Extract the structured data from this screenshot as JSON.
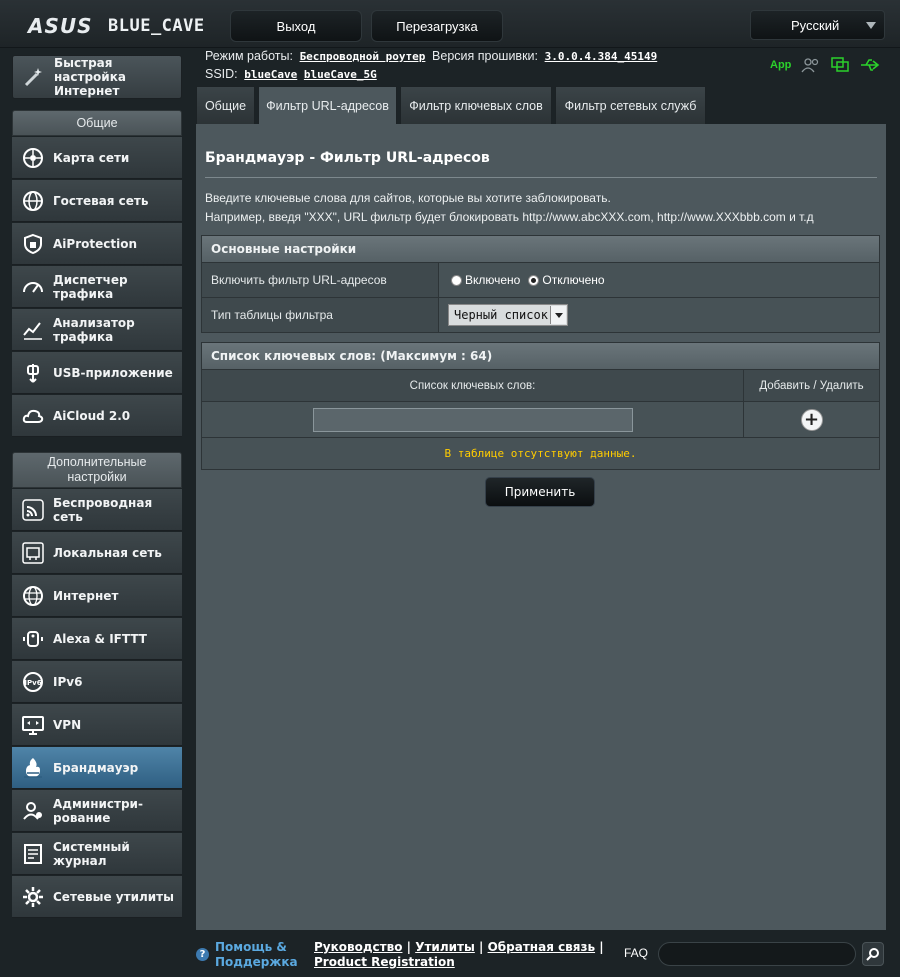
{
  "header": {
    "logo": "ASUS",
    "model": "BLUE_CAVE",
    "logout": "Выход",
    "reboot": "Перезагрузка",
    "language": "Русский"
  },
  "info": {
    "mode_label": "Режим работы:",
    "mode_value": "Беспроводной роутер",
    "firmware_label": "Версия прошивки:",
    "firmware_value": "3.0.0.4.384_45149",
    "ssid_label": "SSID:",
    "ssid_1": "blueCave",
    "ssid_2": "blueCave_5G",
    "app_label": "App"
  },
  "sidebar": {
    "quick_setup": "Быстрая настройка Интернет",
    "general_head": "Общие",
    "general": [
      {
        "label": "Карта сети",
        "icon": "network-map-icon"
      },
      {
        "label": "Гостевая сеть",
        "icon": "guest-network-icon"
      },
      {
        "label": "AiProtection",
        "icon": "aiprotection-icon"
      },
      {
        "label": "Диспетчер трафика",
        "icon": "traffic-manager-icon"
      },
      {
        "label": "Анализатор трафика",
        "icon": "traffic-analyzer-icon"
      },
      {
        "label": "USB-приложение",
        "icon": "usb-icon"
      },
      {
        "label": "AiCloud 2.0",
        "icon": "cloud-icon"
      }
    ],
    "advanced_head": "Дополнительные настройки",
    "advanced": [
      {
        "label": "Беспроводная сеть",
        "icon": "wireless-icon"
      },
      {
        "label": "Локальная сеть",
        "icon": "lan-icon"
      },
      {
        "label": "Интернет",
        "icon": "globe-icon"
      },
      {
        "label": "Alexa & IFTTT",
        "icon": "alexa-icon"
      },
      {
        "label": "IPv6",
        "icon": "ipv6-icon"
      },
      {
        "label": "VPN",
        "icon": "vpn-icon"
      },
      {
        "label": "Брандмауэр",
        "icon": "firewall-icon"
      },
      {
        "label": "Администри- рование",
        "icon": "admin-icon"
      },
      {
        "label": "Системный журнал",
        "icon": "log-icon"
      },
      {
        "label": "Сетевые утилиты",
        "icon": "tools-icon"
      }
    ]
  },
  "tabs": [
    "Общие",
    "Фильтр URL-адресов",
    "Фильтр ключевых слов",
    "Фильтр сетевых служб"
  ],
  "main": {
    "title": "Брандмауэр - Фильтр URL-адресов",
    "desc1": "Введите ключевые слова для сайтов, которые вы хотите заблокировать.",
    "desc2": "Например, введя \"XXX\", URL фильтр будет блокировать http://www.abcXXX.com, http://www.XXXbbb.com и т.д",
    "basic_head": "Основные настройки",
    "enable_label": "Включить фильтр URL-адресов",
    "enable_on": "Включено",
    "enable_off": "Отключено",
    "enable_selected": "Отключено",
    "table_type_label": "Тип таблицы фильтра",
    "table_type_value": "Черный список",
    "list_head": "Список ключевых слов: (Максимум : 64)",
    "col_keywords": "Список ключевых слов:",
    "col_add_delete": "Добавить / Удалить",
    "empty_text": "В таблице отсутствуют данные.",
    "apply": "Применить"
  },
  "footer": {
    "help": "Помощь & Поддержка",
    "manual": "Руководство",
    "utility": "Утилиты",
    "feedback": "Обратная связь",
    "product_registration": "Product Registration",
    "faq": "FAQ"
  }
}
